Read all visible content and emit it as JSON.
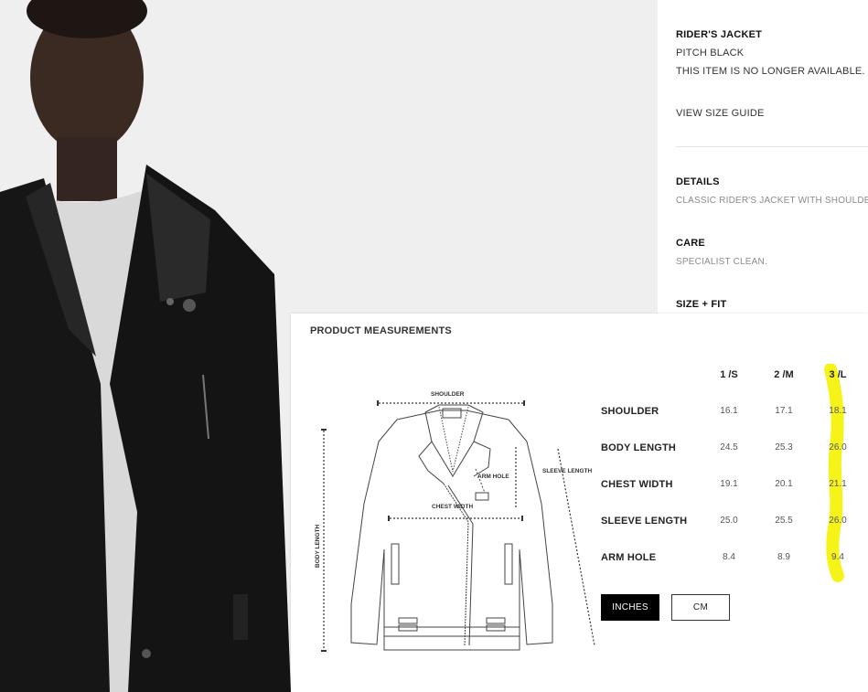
{
  "product": {
    "name": "RIDER'S JACKET",
    "color": "PITCH BLACK",
    "availability": "THIS ITEM IS NO LONGER AVAILABLE.",
    "size_guide_link": "VIEW SIZE GUIDE"
  },
  "sections": {
    "details_heading": "DETAILS",
    "details_text": "CLASSIC RIDER'S JACKET WITH SHOULDE",
    "care_heading": "CARE",
    "care_text": "SPECIALIST CLEAN.",
    "size_fit_heading": "SIZE + FIT"
  },
  "measurements": {
    "title": "PRODUCT MEASUREMENTS",
    "diagram_labels": {
      "shoulder": "SHOULDER",
      "sleeve_length": "SLEEVE LENGTH",
      "arm_hole": "ARM HOLE",
      "chest_width": "CHEST WIDTH",
      "body_length": "BODY LENGTH"
    },
    "sizes": [
      "1 /S",
      "2 /M",
      "3 /L"
    ],
    "rows": [
      {
        "label": "SHOULDER",
        "values": [
          "16.1",
          "17.1",
          "18.1"
        ]
      },
      {
        "label": "BODY LENGTH",
        "values": [
          "24.5",
          "25.3",
          "26.0"
        ]
      },
      {
        "label": "CHEST WIDTH",
        "values": [
          "19.1",
          "20.1",
          "21.1"
        ]
      },
      {
        "label": "SLEEVE LENGTH",
        "values": [
          "25.0",
          "25.5",
          "26.0"
        ]
      },
      {
        "label": "ARM HOLE",
        "values": [
          "8.4",
          "8.9",
          "9.4"
        ]
      }
    ],
    "units": {
      "active": "INCHES",
      "inactive": "CM"
    }
  },
  "colors": {
    "highlight": "#f5f200",
    "active_button": "#000000",
    "photo_background": "#efefef"
  }
}
